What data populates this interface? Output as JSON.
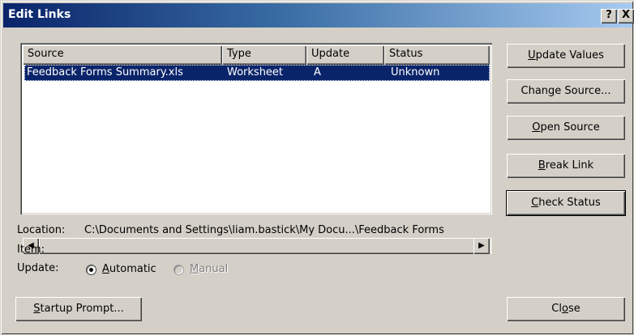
{
  "window": {
    "title": "Edit Links",
    "help_glyph": "?",
    "close_glyph": "X"
  },
  "list": {
    "columns": [
      "Source",
      "Type",
      "Update",
      "Status"
    ],
    "rows": [
      {
        "source": "Feedback Forms Summary.xls",
        "type": "Worksheet",
        "update": "A",
        "status": "Unknown"
      }
    ],
    "scroll_left_glyph": "◀",
    "scroll_right_glyph": "▶"
  },
  "buttons": {
    "update_values": {
      "pre": "",
      "key": "U",
      "post": "pdate Values"
    },
    "change_source": {
      "pre": "Chan",
      "key": "g",
      "post": "e Source..."
    },
    "open_source": {
      "pre": "",
      "key": "O",
      "post": "pen Source"
    },
    "break_link": {
      "pre": "",
      "key": "B",
      "post": "reak Link"
    },
    "check_status": {
      "pre": "",
      "key": "C",
      "post": "heck Status"
    },
    "startup_prompt": {
      "pre": "",
      "key": "S",
      "post": "tartup Prompt..."
    },
    "close": {
      "pre": "Cl",
      "key": "o",
      "post": "se"
    }
  },
  "details": {
    "location_label": "Location:",
    "location_value": "C:\\Documents and Settings\\liam.bastick\\My Docu...\\Feedback Forms",
    "item_label": "Item:",
    "update_label": "Update:",
    "automatic": {
      "pre": "",
      "key": "A",
      "post": "utomatic",
      "checked": true
    },
    "manual": {
      "pre": "",
      "key": "M",
      "post": "anual",
      "checked": false,
      "disabled": true
    }
  },
  "colors": {
    "selection": "#0a246a",
    "face": "#d4d0c8",
    "title_start": "#0a246a",
    "title_end": "#a6caf0"
  }
}
